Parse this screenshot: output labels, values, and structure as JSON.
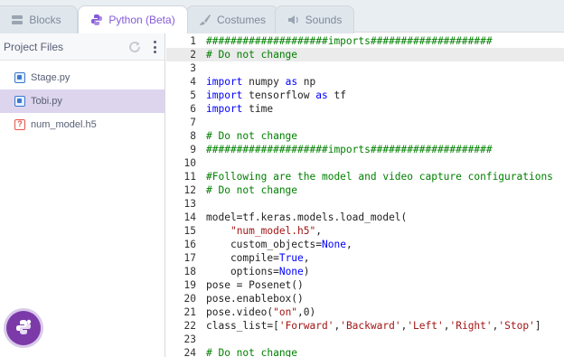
{
  "tabs": {
    "blocks": "Blocks",
    "python": "Python (Beta)",
    "costumes": "Costumes",
    "sounds": "Sounds"
  },
  "sidebar": {
    "title": "Project Files",
    "files": [
      {
        "name": "Stage.py",
        "icon": "python-file-icon"
      },
      {
        "name": "Tobi.py",
        "icon": "python-file-icon",
        "selected": true
      },
      {
        "name": "num_model.h5",
        "icon": "unknown-file-icon"
      }
    ]
  },
  "editor": {
    "active_line": 2,
    "lines": [
      {
        "n": "1",
        "tokens": [
          {
            "t": "####################imports####################",
            "c": "c-comment"
          }
        ]
      },
      {
        "n": "2",
        "tokens": [
          {
            "t": "# Do not change",
            "c": "c-comment"
          }
        ]
      },
      {
        "n": "3",
        "tokens": []
      },
      {
        "n": "4",
        "tokens": [
          {
            "t": "import",
            "c": "c-kw"
          },
          {
            "t": " numpy ",
            "c": "c-plain"
          },
          {
            "t": "as",
            "c": "c-kw"
          },
          {
            "t": " np",
            "c": "c-plain"
          }
        ]
      },
      {
        "n": "5",
        "tokens": [
          {
            "t": "import",
            "c": "c-kw"
          },
          {
            "t": " tensorflow ",
            "c": "c-plain"
          },
          {
            "t": "as",
            "c": "c-kw"
          },
          {
            "t": " tf",
            "c": "c-plain"
          }
        ]
      },
      {
        "n": "6",
        "tokens": [
          {
            "t": "import",
            "c": "c-kw"
          },
          {
            "t": " time",
            "c": "c-plain"
          }
        ]
      },
      {
        "n": "7",
        "tokens": []
      },
      {
        "n": "8",
        "tokens": [
          {
            "t": "# Do not change",
            "c": "c-comment"
          }
        ]
      },
      {
        "n": "9",
        "tokens": [
          {
            "t": "####################imports####################",
            "c": "c-comment"
          }
        ]
      },
      {
        "n": "10",
        "tokens": []
      },
      {
        "n": "11",
        "tokens": [
          {
            "t": "#Following are the model and video capture configurations",
            "c": "c-comment"
          }
        ]
      },
      {
        "n": "12",
        "tokens": [
          {
            "t": "# Do not change",
            "c": "c-comment"
          }
        ]
      },
      {
        "n": "13",
        "tokens": []
      },
      {
        "n": "14",
        "tokens": [
          {
            "t": "model=tf.keras.models.load_model(",
            "c": "c-plain"
          }
        ]
      },
      {
        "n": "15",
        "tokens": [
          {
            "t": "    ",
            "c": "c-plain"
          },
          {
            "t": "\"num_model.h5\"",
            "c": "c-str"
          },
          {
            "t": ",",
            "c": "c-plain"
          }
        ]
      },
      {
        "n": "16",
        "tokens": [
          {
            "t": "    custom_objects=",
            "c": "c-plain"
          },
          {
            "t": "None",
            "c": "c-kw"
          },
          {
            "t": ",",
            "c": "c-plain"
          }
        ]
      },
      {
        "n": "17",
        "tokens": [
          {
            "t": "    compile=",
            "c": "c-plain"
          },
          {
            "t": "True",
            "c": "c-kw"
          },
          {
            "t": ",",
            "c": "c-plain"
          }
        ]
      },
      {
        "n": "18",
        "tokens": [
          {
            "t": "    options=",
            "c": "c-plain"
          },
          {
            "t": "None",
            "c": "c-kw"
          },
          {
            "t": ")",
            "c": "c-plain"
          }
        ]
      },
      {
        "n": "19",
        "tokens": [
          {
            "t": "pose = Posenet()",
            "c": "c-plain"
          }
        ]
      },
      {
        "n": "20",
        "tokens": [
          {
            "t": "pose.enablebox()",
            "c": "c-plain"
          }
        ]
      },
      {
        "n": "21",
        "tokens": [
          {
            "t": "pose.video(",
            "c": "c-plain"
          },
          {
            "t": "\"on\"",
            "c": "c-str"
          },
          {
            "t": ",0)",
            "c": "c-plain"
          }
        ]
      },
      {
        "n": "22",
        "tokens": [
          {
            "t": "class_list=[",
            "c": "c-plain"
          },
          {
            "t": "'Forward'",
            "c": "c-str"
          },
          {
            "t": ",",
            "c": "c-plain"
          },
          {
            "t": "'Backward'",
            "c": "c-str"
          },
          {
            "t": ",",
            "c": "c-plain"
          },
          {
            "t": "'Left'",
            "c": "c-str"
          },
          {
            "t": ",",
            "c": "c-plain"
          },
          {
            "t": "'Right'",
            "c": "c-str"
          },
          {
            "t": ",",
            "c": "c-plain"
          },
          {
            "t": "'Stop'",
            "c": "c-str"
          },
          {
            "t": "]",
            "c": "c-plain"
          }
        ]
      },
      {
        "n": "23",
        "tokens": []
      },
      {
        "n": "24",
        "tokens": [
          {
            "t": "# Do not change",
            "c": "c-comment"
          }
        ]
      }
    ]
  },
  "colors": {
    "accent": "#855cd6",
    "fab": "#7b3aa8",
    "selected_row": "#ddd5ee"
  }
}
